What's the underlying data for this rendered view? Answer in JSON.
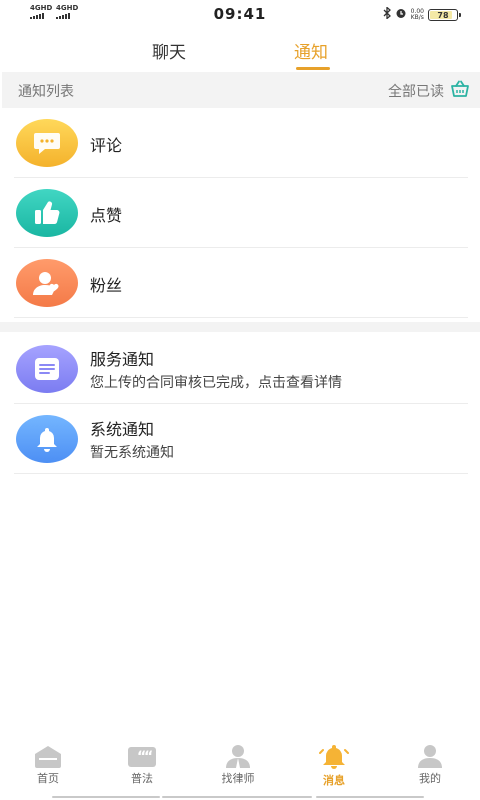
{
  "status_bar": {
    "signal1": "4GHD",
    "signal2": "4GHD",
    "time": "09:41",
    "net_speed_value": "0.00",
    "net_speed_unit": "KB/s",
    "battery": "78",
    "battery_level": 0.78
  },
  "tabs": [
    {
      "label": "聊天",
      "active": false
    },
    {
      "label": "通知",
      "active": true
    }
  ],
  "list_header": {
    "title": "通知列表",
    "mark_all_read": "全部已读"
  },
  "items": [
    {
      "title": "评论",
      "icon": "comment-bubble-icon"
    },
    {
      "title": "点赞",
      "icon": "thumbs-up-icon"
    },
    {
      "title": "粉丝",
      "icon": "follower-icon"
    },
    {
      "title": "服务通知",
      "subtitle": "您上传的合同审核已完成，点击查看详情",
      "icon": "document-icon"
    },
    {
      "title": "系统通知",
      "subtitle": "暂无系统通知",
      "icon": "bell-icon"
    }
  ],
  "bottom_nav": [
    {
      "label": "首页",
      "icon": "home-icon",
      "active": false
    },
    {
      "label": "普法",
      "icon": "quote-icon",
      "active": false
    },
    {
      "label": "找律师",
      "icon": "lawyer-icon",
      "active": false
    },
    {
      "label": "消息",
      "icon": "bell-icon",
      "active": true
    },
    {
      "label": "我的",
      "icon": "profile-icon",
      "active": false
    }
  ],
  "colors": {
    "accent": "#e7a12a",
    "header_bg": "#f3f3f3",
    "mark_read_icon": "#2bb3a3"
  }
}
